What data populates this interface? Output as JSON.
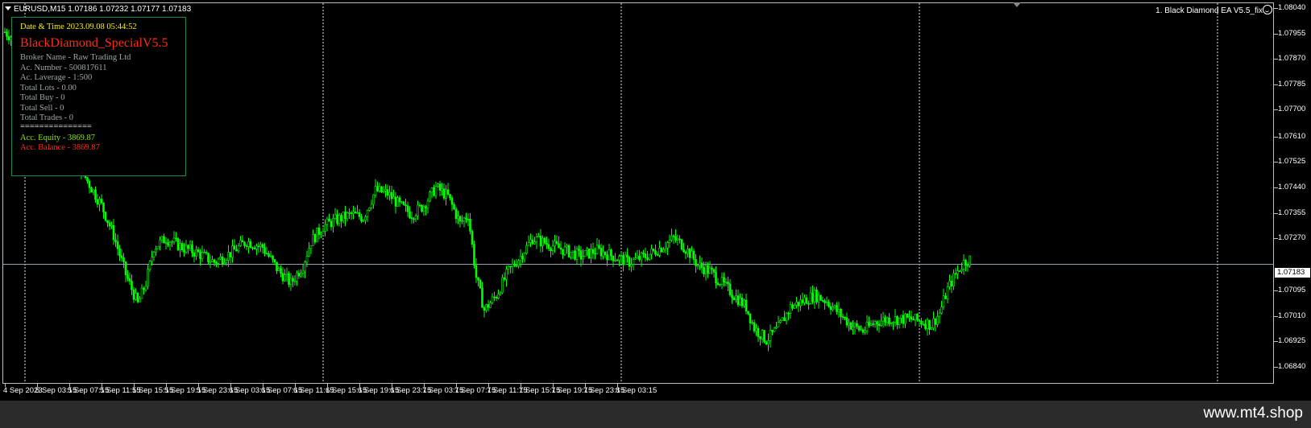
{
  "symbol_info": "EURUSD,M15  1.07186 1.07232 1.07177 1.07183",
  "ea_label": "1. Black Diamond EA  V5.5_fix",
  "icons": {
    "dropdown": "triangle-down-icon",
    "ea_status": "smiley-icon"
  },
  "info_panel": {
    "datetime": "Date & Time 2023.09.08 05:44:52",
    "title": "BlackDiamond_SpecialV5.5",
    "broker": "Broker Name - Raw Trading Ltd",
    "account_number": "Ac. Number - 500817611",
    "leverage": "Ac. Laverage - 1:500",
    "total_lots": "Total Lots - 0.00",
    "total_buy": "Total Buy - 0",
    "total_sell": "Total Sell - 0",
    "total_trades": "Total Trades - 0",
    "separator": "===============",
    "equity": "Acc. Equity - 3869.87",
    "balance": "Acc. Balance - 3869.87"
  },
  "current_price": "1.07183",
  "colors": {
    "candle": "#00ff00",
    "background": "#000000",
    "panel_border": "#1f8a4f",
    "equity": "#8ee600",
    "balance": "#ff2b12",
    "title": "#ff2b12",
    "datetime": "#f5f500"
  },
  "chart_data": {
    "type": "candlestick",
    "title": "",
    "y_ticks": [
      "1.08040",
      "1.07955",
      "1.07870",
      "1.07785",
      "1.07700",
      "1.07610",
      "1.07525",
      "1.07440",
      "1.07355",
      "1.07270",
      "1.07183",
      "1.07095",
      "1.07010",
      "1.06925",
      "1.06840"
    ],
    "x_ticks": [
      "4 Sep 2023",
      "5 Sep 03:15",
      "5 Sep 07:15",
      "5 Sep 11:15",
      "5 Sep 15:15",
      "5 Sep 19:15",
      "5 Sep 23:15",
      "6 Sep 03:15",
      "6 Sep 07:15",
      "6 Sep 11:15",
      "6 Sep 15:15",
      "6 Sep 19:15",
      "6 Sep 23:15",
      "7 Sep 03:15",
      "7 Sep 07:15",
      "7 Sep 11:15",
      "7 Sep 15:15",
      "7 Sep 19:15",
      "7 Sep 23:15",
      "8 Sep 03:15"
    ],
    "ylim": [
      1.0684,
      1.0804
    ],
    "current_price": 1.07183,
    "grid": false,
    "period_separators": [
      "5 Sep 00:00",
      "6 Sep 00:00",
      "7 Sep 00:00",
      "8 Sep 00:00"
    ],
    "close_path": [
      [
        0,
        1.0796
      ],
      [
        12,
        1.079
      ],
      [
        22,
        1.0778
      ],
      [
        30,
        1.0765
      ],
      [
        36,
        1.0752
      ],
      [
        42,
        1.0745
      ],
      [
        48,
        1.0738
      ],
      [
        54,
        1.0728
      ],
      [
        60,
        1.0715
      ],
      [
        66,
        1.0705
      ],
      [
        70,
        1.0712
      ],
      [
        74,
        1.0724
      ],
      [
        80,
        1.0727
      ],
      [
        88,
        1.0724
      ],
      [
        96,
        1.0722
      ],
      [
        104,
        1.0719
      ],
      [
        112,
        1.0722
      ],
      [
        120,
        1.0726
      ],
      [
        128,
        1.0724
      ],
      [
        136,
        1.0716
      ],
      [
        142,
        1.0712
      ],
      [
        148,
        1.0718
      ],
      [
        152,
        1.0726
      ],
      [
        158,
        1.0731
      ],
      [
        164,
        1.0733
      ],
      [
        172,
        1.0735
      ],
      [
        178,
        1.0734
      ],
      [
        184,
        1.0743
      ],
      [
        190,
        1.0742
      ],
      [
        196,
        1.0738
      ],
      [
        202,
        1.0735
      ],
      [
        208,
        1.0738
      ],
      [
        214,
        1.0744
      ],
      [
        220,
        1.0741
      ],
      [
        226,
        1.0732
      ],
      [
        230,
        1.0735
      ],
      [
        234,
        1.0714
      ],
      [
        238,
        1.0703
      ],
      [
        244,
        1.0708
      ],
      [
        250,
        1.0716
      ],
      [
        256,
        1.0721
      ],
      [
        262,
        1.0727
      ],
      [
        270,
        1.0725
      ],
      [
        278,
        1.0723
      ],
      [
        286,
        1.0721
      ],
      [
        294,
        1.0723
      ],
      [
        302,
        1.0721
      ],
      [
        310,
        1.0719
      ],
      [
        318,
        1.0721
      ],
      [
        326,
        1.0724
      ],
      [
        332,
        1.0727
      ],
      [
        336,
        1.0725
      ],
      [
        340,
        1.0722
      ],
      [
        344,
        1.0718
      ],
      [
        350,
        1.0716
      ],
      [
        356,
        1.0712
      ],
      [
        362,
        1.0708
      ],
      [
        368,
        1.0704
      ],
      [
        372,
        1.0697
      ],
      [
        378,
        1.0693
      ],
      [
        384,
        1.0697
      ],
      [
        390,
        1.0704
      ],
      [
        396,
        1.0706
      ],
      [
        402,
        1.0708
      ],
      [
        408,
        1.0706
      ],
      [
        414,
        1.0702
      ],
      [
        420,
        1.0698
      ],
      [
        426,
        1.0696
      ],
      [
        432,
        1.0699
      ],
      [
        438,
        1.07
      ],
      [
        444,
        1.07
      ],
      [
        450,
        1.07
      ],
      [
        456,
        1.0699
      ],
      [
        460,
        1.0698
      ],
      [
        464,
        1.0702
      ],
      [
        468,
        1.071
      ],
      [
        472,
        1.0715
      ],
      [
        476,
        1.0719
      ],
      [
        479,
        1.072
      ]
    ]
  }
}
